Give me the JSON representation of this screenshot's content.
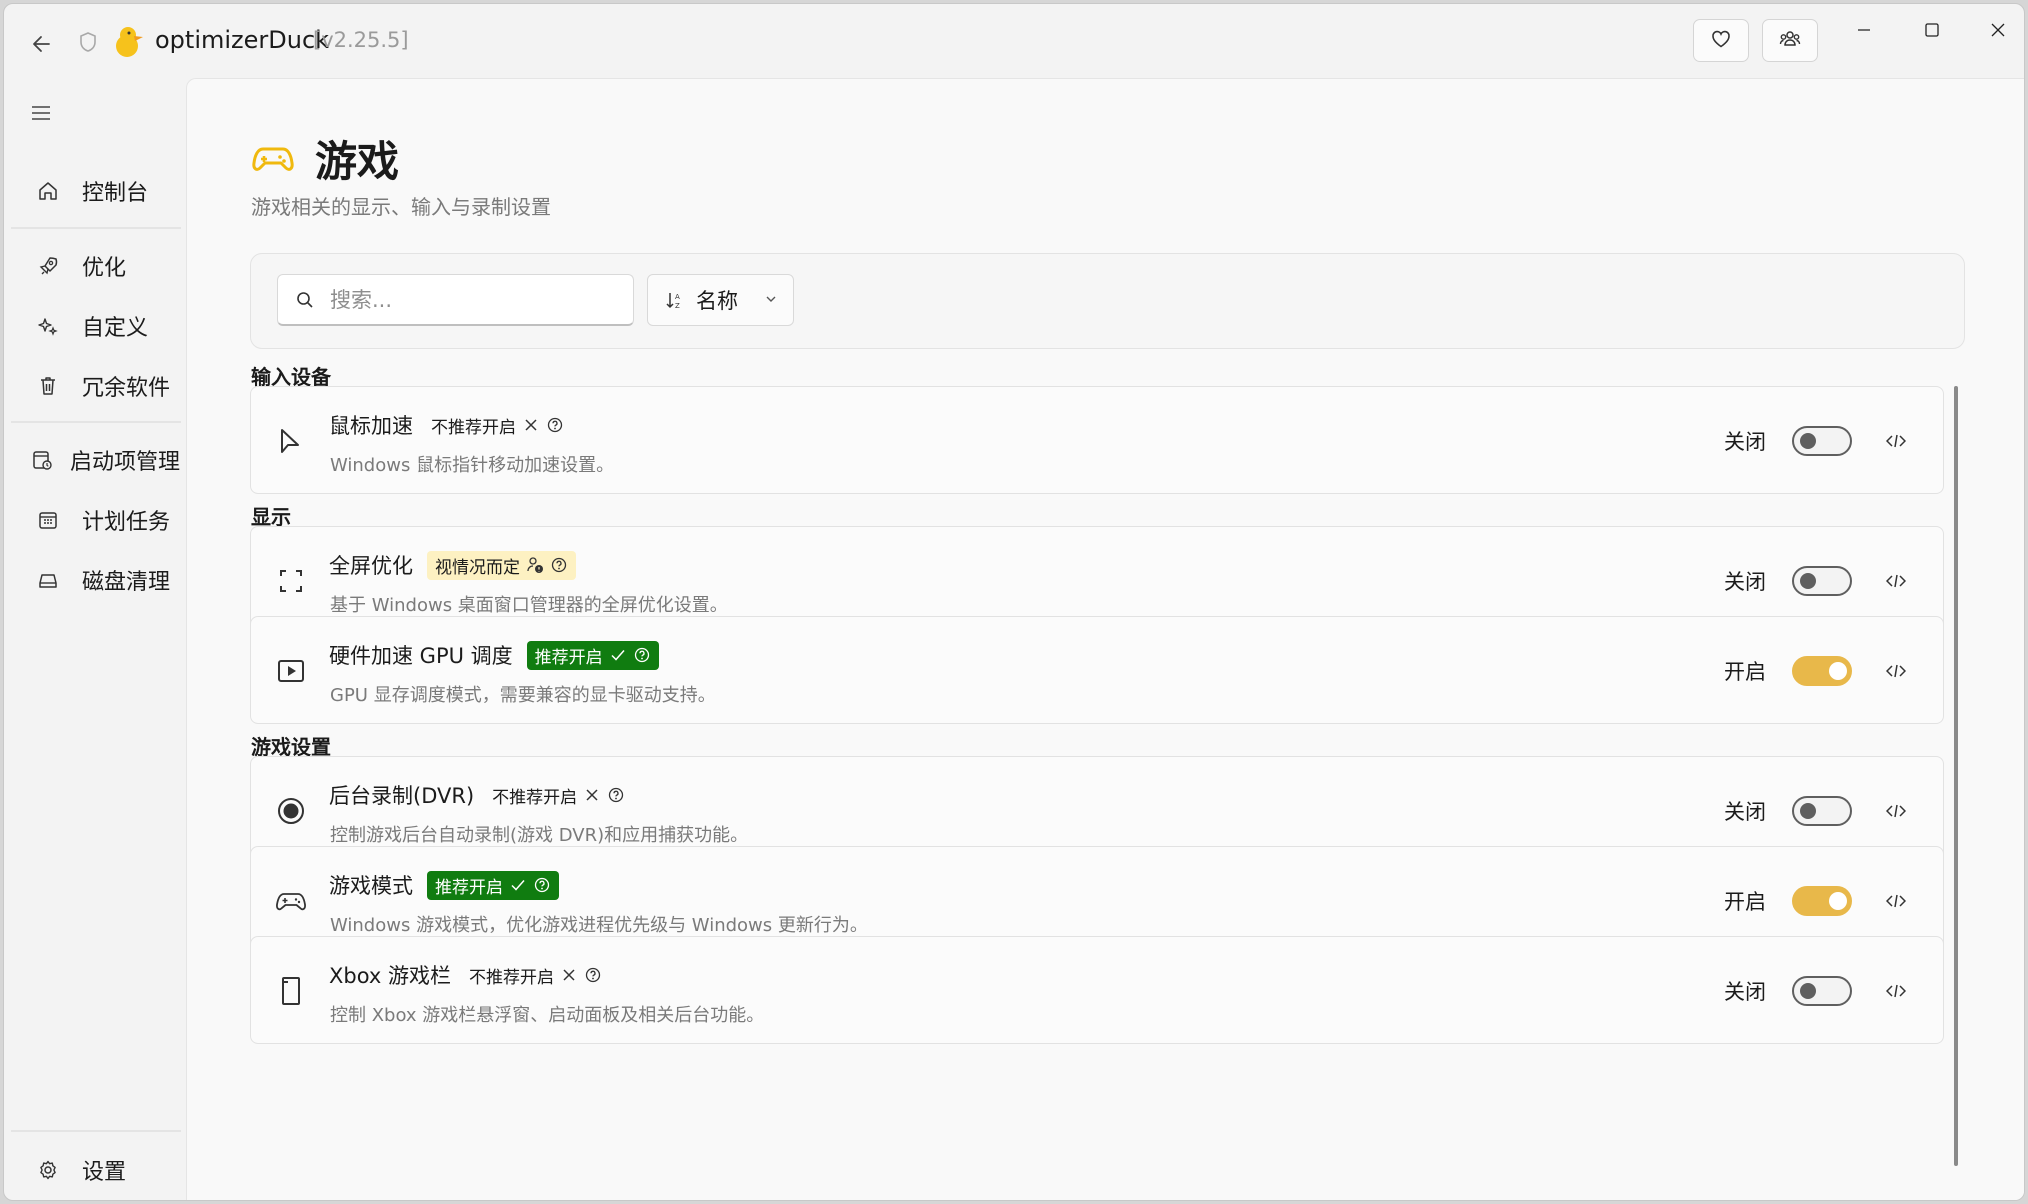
{
  "app": {
    "title": "optimizerDuck",
    "version": "[v2.25.5]"
  },
  "sidebar": {
    "items": [
      {
        "label": "控制台",
        "icon": "home-icon"
      },
      {
        "label": "优化",
        "icon": "rocket-icon"
      },
      {
        "label": "自定义",
        "icon": "sparkle-icon"
      },
      {
        "label": "冗余软件",
        "icon": "trash-icon"
      },
      {
        "label": "启动项管理",
        "icon": "startup-icon"
      },
      {
        "label": "计划任务",
        "icon": "calendar-icon"
      },
      {
        "label": "磁盘清理",
        "icon": "drive-icon"
      }
    ],
    "settings_label": "设置"
  },
  "page": {
    "title": "游戏",
    "subtitle": "游戏相关的显示、输入与录制设置"
  },
  "filter": {
    "search_placeholder": "搜索...",
    "sort_label": "名称"
  },
  "sections": [
    {
      "title": "输入设备",
      "items": [
        {
          "title": "鼠标加速",
          "badge": "不推荐开启",
          "badge_type": "neutral",
          "desc": "Windows 鼠标指针移动加速设置。",
          "state": "关闭",
          "on": false,
          "icon": "cursor-icon"
        }
      ]
    },
    {
      "title": "显示",
      "items": [
        {
          "title": "全屏优化",
          "badge": "视情况而定",
          "badge_type": "warn",
          "desc": "基于 Windows 桌面窗口管理器的全屏优化设置。",
          "state": "关闭",
          "on": false,
          "icon": "fullscreen-icon"
        },
        {
          "title": "硬件加速 GPU 调度",
          "badge": "推荐开启",
          "badge_type": "good",
          "desc": "GPU 显存调度模式，需要兼容的显卡驱动支持。",
          "state": "开启",
          "on": true,
          "icon": "play-icon"
        }
      ]
    },
    {
      "title": "游戏设置",
      "items": [
        {
          "title": "后台录制(DVR)",
          "badge": "不推荐开启",
          "badge_type": "neutral",
          "desc": "控制游戏后台自动录制(游戏 DVR)和应用捕获功能。",
          "state": "关闭",
          "on": false,
          "icon": "record-icon"
        },
        {
          "title": "游戏模式",
          "badge": "推荐开启",
          "badge_type": "good",
          "desc": "Windows 游戏模式，优化游戏进程优先级与 Windows 更新行为。",
          "state": "开启",
          "on": true,
          "icon": "gamepad-icon"
        },
        {
          "title": "Xbox 游戏栏",
          "badge": "不推荐开启",
          "badge_type": "neutral",
          "desc": "控制 Xbox 游戏栏悬浮窗、启动面板及相关后台功能。",
          "state": "关闭",
          "on": false,
          "icon": "gamebar-icon"
        }
      ]
    }
  ],
  "colors": {
    "accent": "#e8b84a",
    "recommend": "#107c10",
    "warn_bg": "#fdf1c2"
  }
}
